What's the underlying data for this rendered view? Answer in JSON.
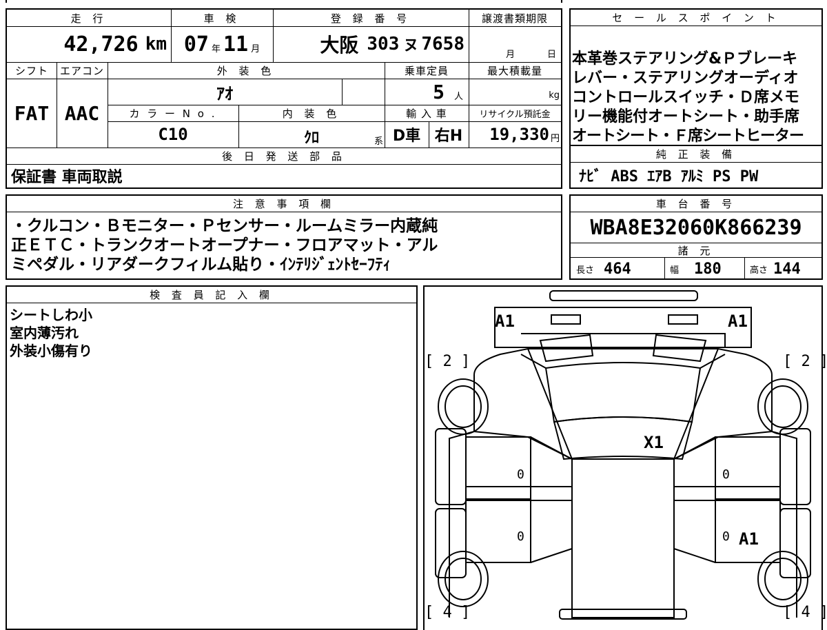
{
  "top_table": {
    "headers": {
      "mileage": "走 行",
      "inspection": "車 検",
      "registration": "登 録 番 号",
      "transfer_deadline": "譲渡書類期限",
      "shift": "シフト",
      "aircon": "エアコン",
      "exterior_color": "外 装 色",
      "capacity": "乗車定員",
      "max_load": "最大積載量",
      "color_no": "カ ラ ー N o .",
      "interior_color": "内 装 色",
      "import_car": "輸 入 車",
      "recycle_fee": "リサイクル預託金",
      "later_parts": "後 日 発 送 部 品"
    },
    "mileage_value": "42,726",
    "mileage_unit": "km",
    "inspection_year": "07",
    "inspection_year_unit": "年",
    "inspection_month": "11",
    "inspection_month_unit": "月",
    "reg_area": "大阪",
    "reg_class": "303",
    "reg_kana": "ヌ",
    "reg_number": "7658",
    "transfer_month_unit": "月",
    "transfer_day_unit": "日",
    "shift_value": "FAT",
    "aircon_value": "AAC",
    "exterior_color_value": "ｱｵ",
    "capacity_value": "5",
    "capacity_unit": "人",
    "max_load_unit": "kg",
    "color_no_value": "C10",
    "interior_color_value": "ｸﾛ",
    "interior_color_suffix": "系",
    "import_type": "D車",
    "handle_side": "右H",
    "recycle_value": "19,330",
    "recycle_unit": "円",
    "later_parts_value": "保証書 車両取説"
  },
  "sales_points": {
    "header": "セ ー ル ス ポ イ ン ト",
    "lines": [
      "本革巻ステアリング&Ｐブレーキ",
      "レバー・ステアリングオーディオ",
      "コントロールスイッチ・Ｄ席メモ",
      "リー機能付オートシート・助手席",
      "オートシート・Ｆ席シートヒーター"
    ]
  },
  "genuine_equipment": {
    "header": "純 正 装 備",
    "value": "ﾅﾋﾞ ABS ｴｱB ｱﾙﾐ PS PW"
  },
  "notes": {
    "header": "注 意 事 項 欄",
    "lines": [
      "・クルコン・Ｂモニター・Ｐセンサー・ルームミラー内蔵純",
      "正ＥＴＣ・トランクオートオープナー・フロアマット・アル",
      "ミペダル・リアダークフィルム貼り・ｲﾝﾃﾘｼﾞｪﾝﾄｾｰﾌﾃｨ"
    ]
  },
  "chassis": {
    "header": "車 台 番 号",
    "value": "WBA8E32060K866239",
    "spec_header": "諸 元",
    "length_label": "長さ",
    "length_value": "464",
    "width_label": "幅",
    "width_value": "180",
    "height_label": "高さ",
    "height_value": "144"
  },
  "inspector": {
    "header": "検 査 員 記 入 欄",
    "lines": [
      "シートしわ小",
      "室内薄汚れ",
      "外装小傷有り"
    ]
  },
  "diagram": {
    "marks": {
      "front_left": "A1",
      "front_right": "A1",
      "windshield": "X1",
      "rear_right_door": "A1"
    },
    "tire_front_left": "[ 2 ]",
    "tire_front_right": "[ 2 ]",
    "tire_rear_left": "[ 4 ]",
    "tire_rear_right": "[ 4 ]",
    "door_left_front": "0",
    "door_left_rear": "0",
    "door_right_front": "0",
    "door_right_rear": "0"
  }
}
